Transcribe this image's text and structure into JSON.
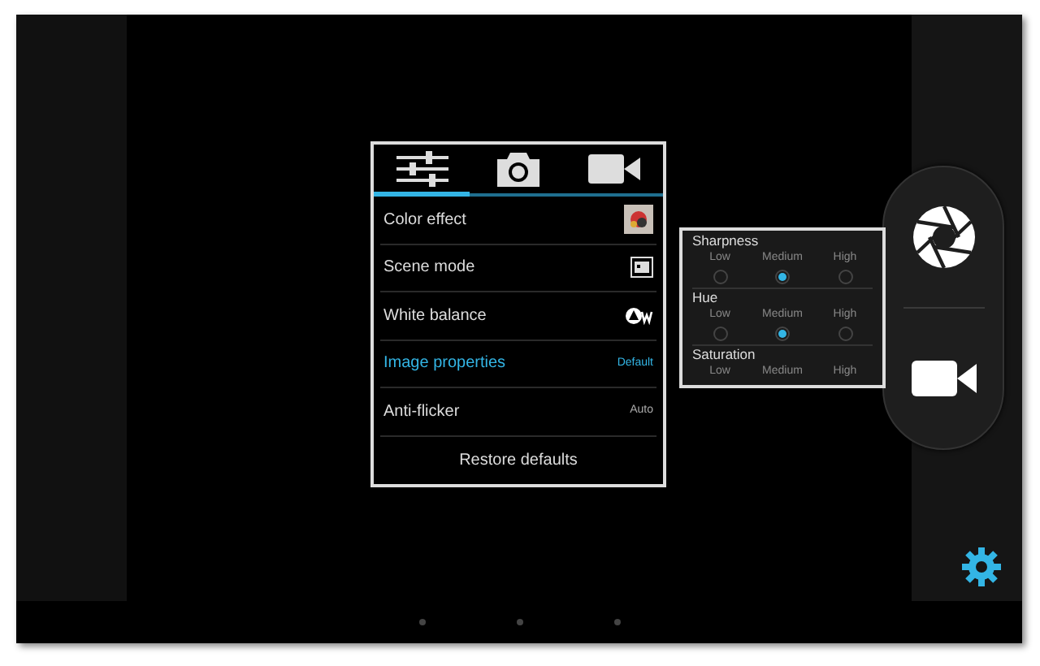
{
  "tabs": [
    {
      "kind": "settings",
      "selected": true
    },
    {
      "kind": "camera",
      "selected": false
    },
    {
      "kind": "video",
      "selected": false
    }
  ],
  "menu": [
    {
      "label": "Color effect",
      "kind": "color-icon",
      "selected": false
    },
    {
      "label": "Scene mode",
      "kind": "scene-icon",
      "selected": false
    },
    {
      "label": "White balance",
      "kind": "wb-icon",
      "selected": false
    },
    {
      "label": "Image properties",
      "kind": "text",
      "value": "Default",
      "selected": true
    },
    {
      "label": "Anti-flicker",
      "kind": "text",
      "value": "Auto",
      "selected": false
    },
    {
      "label": "Restore defaults",
      "kind": "action",
      "selected": false
    }
  ],
  "properties": [
    {
      "label": "Sharpness",
      "options": [
        {
          "label": "Low",
          "selected": false
        },
        {
          "label": "Medium",
          "selected": true
        },
        {
          "label": "High",
          "selected": false
        }
      ]
    },
    {
      "label": "Hue",
      "options": [
        {
          "label": "Low",
          "selected": false
        },
        {
          "label": "Medium",
          "selected": true
        },
        {
          "label": "High",
          "selected": false
        }
      ]
    },
    {
      "label": "Saturation",
      "options": [
        {
          "label": "Low"
        },
        {
          "label": "Medium"
        },
        {
          "label": "High"
        }
      ]
    }
  ]
}
